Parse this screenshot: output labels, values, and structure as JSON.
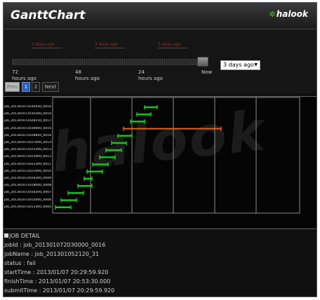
{
  "app": {
    "title": "GanttChart",
    "logo": "halook"
  },
  "timeline": {
    "markers": [
      {
        "label": "3 days ago"
      },
      {
        "label": "3 days ago"
      },
      {
        "label": "3 days ago"
      }
    ],
    "ticks": [
      {
        "value": "72",
        "unit": "hours ago"
      },
      {
        "value": "48",
        "unit": "hours ago"
      },
      {
        "value": "24",
        "unit": "hours ago"
      },
      {
        "value": "Now",
        "unit": ""
      }
    ],
    "range_select": {
      "selected": "3 days ago"
    },
    "slider_position": 0.97
  },
  "pager": {
    "prev": "Prev",
    "pages": [
      "1",
      "2"
    ],
    "active_page": "1",
    "next": "Next"
  },
  "chart": {
    "watermark": "halook",
    "colors": {
      "job": "#18c418",
      "selected": "#e0641c",
      "grid": "#8a8a8a"
    },
    "jobs": [
      "job_201301072030430_0016",
      "job_201301072030300_0016",
      "job_201301072028150_0017",
      "job_201301072030000_0016",
      "job_201301072028850_0016",
      "job_201301072027000_0014",
      "job_201301072025300_0013",
      "job_201301072023400_0012",
      "job_201301072022300_0011",
      "job_201301072021000_0010",
      "job_201301072019300_0009",
      "job_201301072018000_0008",
      "job_201301072016300_0007",
      "job_201301072015000_0006",
      "job_201301072013300_0005"
    ]
  },
  "detail": {
    "header": "JOB DETAIL",
    "lines": [
      "jobId : job_201301072030000_0016",
      "jobName : job_201301052120_31",
      "status : fail",
      "startTime : 2013/01/07 20:29:59.920",
      "finishTime : 2013/01/07 20:53:30.000",
      "submitTime : 2013/01/07 20:29:59.920"
    ]
  }
}
